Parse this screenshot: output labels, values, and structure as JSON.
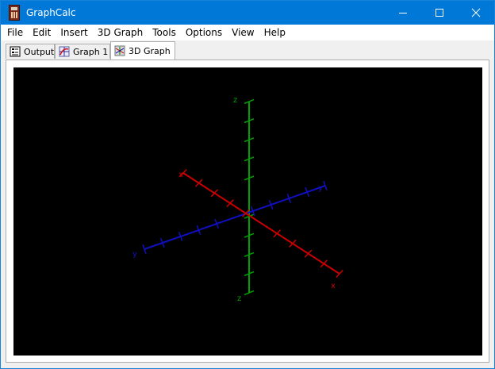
{
  "window": {
    "title": "GraphCalc"
  },
  "menubar": {
    "items": [
      "File",
      "Edit",
      "Insert",
      "3D Graph",
      "Tools",
      "Options",
      "View",
      "Help"
    ]
  },
  "tabs": [
    {
      "label": "Output",
      "icon": "output-icon",
      "active": false
    },
    {
      "label": "Graph 1",
      "icon": "graph-icon",
      "active": false
    },
    {
      "label": "3D Graph",
      "icon": "graph3d-icon",
      "active": true
    }
  ],
  "graph3d": {
    "background": "#000000",
    "axes": [
      {
        "name": "x",
        "color": "#cc0000",
        "label": "x"
      },
      {
        "name": "y",
        "color": "#1010c0",
        "label": "y"
      },
      {
        "name": "z",
        "color": "#00a000",
        "label": "z"
      }
    ]
  }
}
